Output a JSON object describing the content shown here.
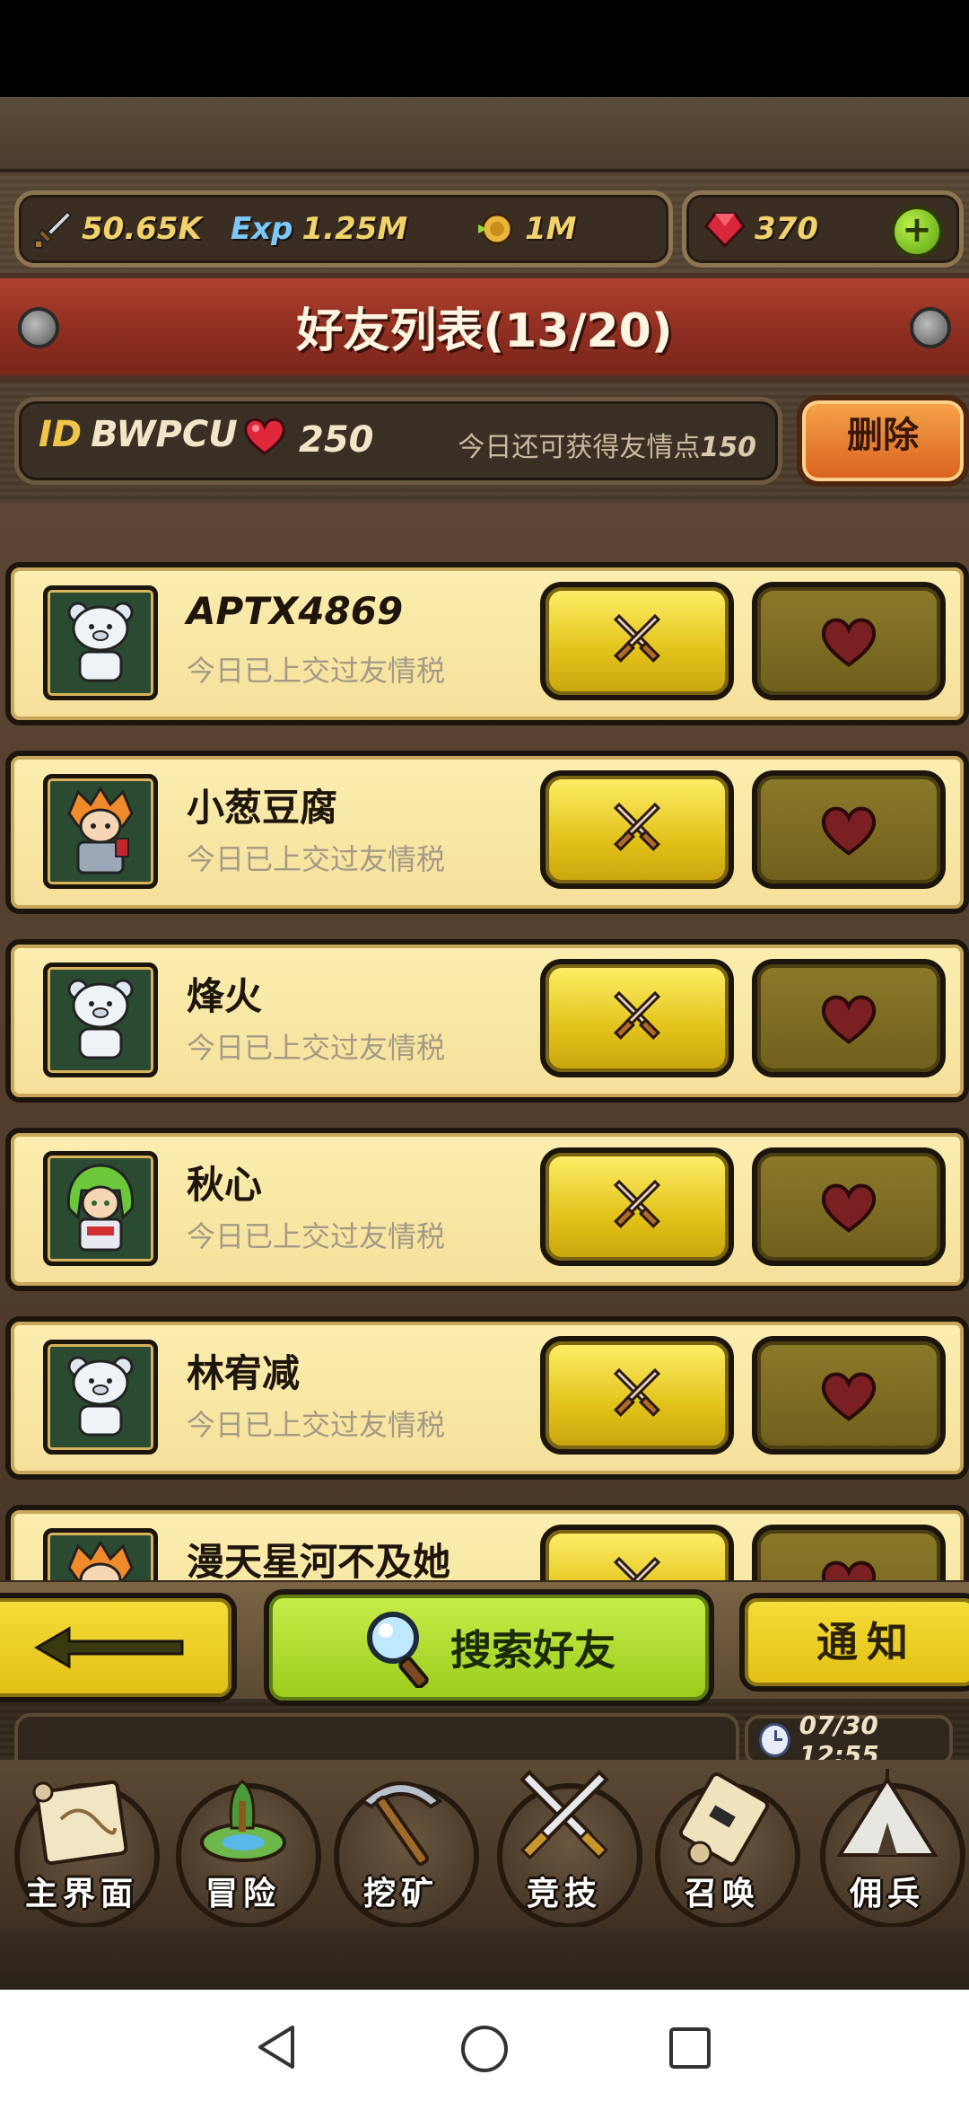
{
  "resources": {
    "attack": "50.65K",
    "exp_icon": "Exp",
    "exp": "1.25M",
    "gold": "1M",
    "gems": "370"
  },
  "title": "好友列表(13/20)",
  "info": {
    "id_label": "ID",
    "id_value": "BWPCU",
    "hearts": "250",
    "today_label": "今日还可获得友情点",
    "today_value": "150",
    "delete_label": "删除"
  },
  "friends": [
    {
      "name": "APTX4869",
      "status": "今日已上交过友情税",
      "avatar": "white-bear"
    },
    {
      "name": "小葱豆腐",
      "status": "今日已上交过友情税",
      "avatar": "orange-hair-knight"
    },
    {
      "name": "烽火",
      "status": "今日已上交过友情税",
      "avatar": "white-bear"
    },
    {
      "name": "秋心",
      "status": "今日已上交过友情税",
      "avatar": "green-hair-girl"
    },
    {
      "name": "林宥减",
      "status": "今日已上交过友情税",
      "avatar": "white-bear"
    },
    {
      "name": "漫天星河不及她",
      "status": "",
      "avatar": "orange-hair-knight"
    }
  ],
  "actions": {
    "search_label": "搜索好友",
    "notice_label": "通知"
  },
  "clock_text": "07/30 12:55",
  "nav": [
    {
      "label": "主界面",
      "icon": "map-scroll"
    },
    {
      "label": "冒险",
      "icon": "island"
    },
    {
      "label": "挖矿",
      "icon": "pickaxe"
    },
    {
      "label": "竞技",
      "icon": "crossed-swords"
    },
    {
      "label": "召唤",
      "icon": "summon-scroll"
    },
    {
      "label": "佣兵",
      "icon": "tent"
    }
  ],
  "colors": {
    "title_banner": "#9a3425",
    "row_bg": "#f7e6a4",
    "battle_button": "#f0d62a",
    "heart_button": "#7a6a22",
    "search_button": "#b4e034"
  }
}
